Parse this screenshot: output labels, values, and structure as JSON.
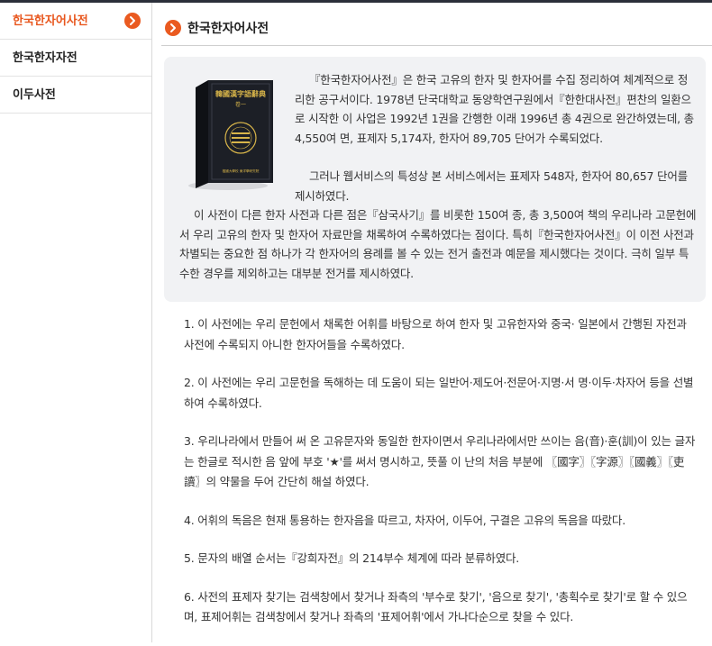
{
  "sidebar": {
    "items": [
      {
        "label": "한국한자어사전",
        "active": true
      },
      {
        "label": "한국한자자전",
        "active": false
      },
      {
        "label": "이두사전",
        "active": false
      }
    ]
  },
  "main": {
    "title": "한국한자어사전",
    "intro": {
      "book_cover_title": "韓國漢字語辭典",
      "book_cover_volume": "卷一",
      "book_cover_center": "檀國大學校 東洋學研究院",
      "paragraphs": [
        "『한국한자어사전』은 한국 고유의 한자 및 한자어를 수집 정리하여 체계적으로 정리한 공구서이다. 1978년 단국대학교 동양학연구원에서『한한대사전』편찬의 일환으로 시작한 이 사업은 1992년 1권을 간행한 이래 1996년 총 4권으로 완간하였는데, 총 4,550여 면, 표제자 5,174자, 한자어 89,705 단어가 수록되었다.",
        "그러나 웹서비스의 특성상 본 서비스에서는 표제자 548자, 한자어 80,657 단어를 제시하였다.",
        "이 사전이 다른 한자 사전과 다른 점은『삼국사기』를 비롯한 150여 종, 총 3,500여 책의 우리나라 고문헌에서 우리 고유의 한자 및 한자어 자료만을 채록하여 수록하였다는 점이다. 특히『한국한자어사전』이 이전 사전과 차별되는 중요한 점 하나가 각 한자어의 용례를 볼 수 있는 전거 출전과 예문을 제시했다는 것이다. 극히 일부 특수한 경우를 제외하고는 대부분 전거를 제시하였다."
      ]
    },
    "notes": [
      "1. 이 사전에는 우리 문헌에서 채록한 어휘를 바탕으로 하여 한자 및 고유한자와 중국· 일본에서 간행된 자전과 사전에 수록되지 아니한 한자어들을 수록하였다.",
      "2. 이 사전에는 우리 고문헌을 독해하는 데 도움이 되는 일반어·제도어·전문어·지명·서 명·이두·차자어 등을 선별하여 수록하였다.",
      "3. 우리나라에서 만들어 써 온 고유문자와 동일한 한자이면서 우리나라에서만 쓰이는 음(音)·훈(訓)이 있는 글자는 한글로 적시한 음 앞에 부호 '★'를 써서 명시하고, 뜻풀 이 난의 처음 부분에 〖國字〗〖字源〗〖國義〗〖吏讀〗의 약물을 두어 간단히 해설 하였다.",
      "4. 어휘의 독음은 현재 통용하는 한자음을 따르고, 차자어, 이두어, 구결은 고유의 독음을 따랐다.",
      "5. 문자의 배열 순서는『강희자전』의 214부수 체계에 따라 분류하였다.",
      "6. 사전의 표제자 찾기는 검색창에서 찾거나 좌측의 '부수로 찾기', '음으로 찾기', '총획수로 찾기'로 할 수 있으며, 표제어휘는 검색창에서 찾거나 좌측의 '표제어휘'에서 가나다순으로 찾을 수 있다."
    ]
  },
  "colors": {
    "accent": "#ea5a20",
    "intro_bg": "#f1f2f4",
    "book_cover": "#1c1f26",
    "book_gold": "#d8b54a"
  }
}
